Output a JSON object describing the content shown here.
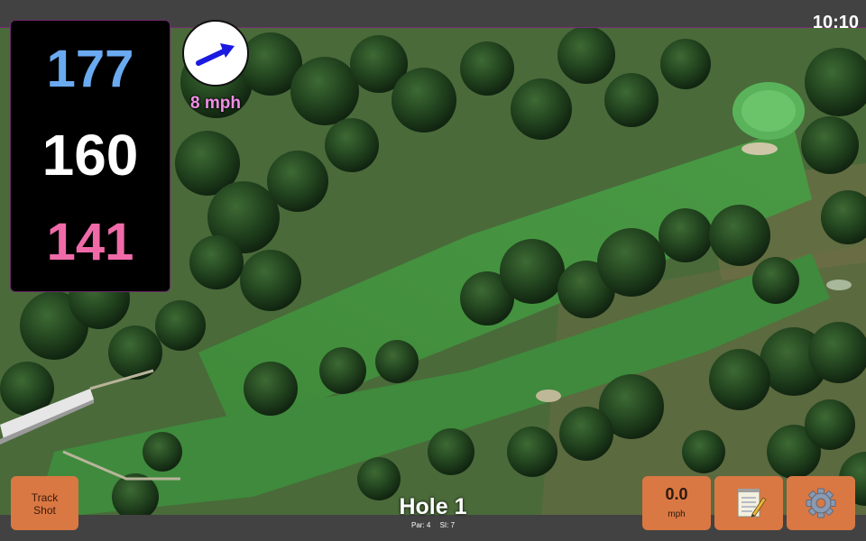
{
  "status": {
    "time": "10:10"
  },
  "distances": {
    "back": "177",
    "middle": "160",
    "front": "141",
    "colors": {
      "back": "#6aaaf0",
      "middle": "#ffffff",
      "front": "#f06aa8"
    }
  },
  "wind": {
    "speed_label": "8 mph",
    "direction_icon": "wind-arrow-icon",
    "arrow_color": "#1a1ae0"
  },
  "buttons": {
    "track_shot": {
      "line1": "Track",
      "line2": "Shot"
    },
    "speed": {
      "value": "0.0",
      "unit": "mph"
    },
    "notes": {
      "icon": "notepad-icon"
    },
    "settings": {
      "icon": "gear-icon"
    },
    "accent_color": "#d97843"
  },
  "hole": {
    "title": "Hole 1",
    "par": "Par: 4",
    "stroke_index": "SI: 7"
  }
}
